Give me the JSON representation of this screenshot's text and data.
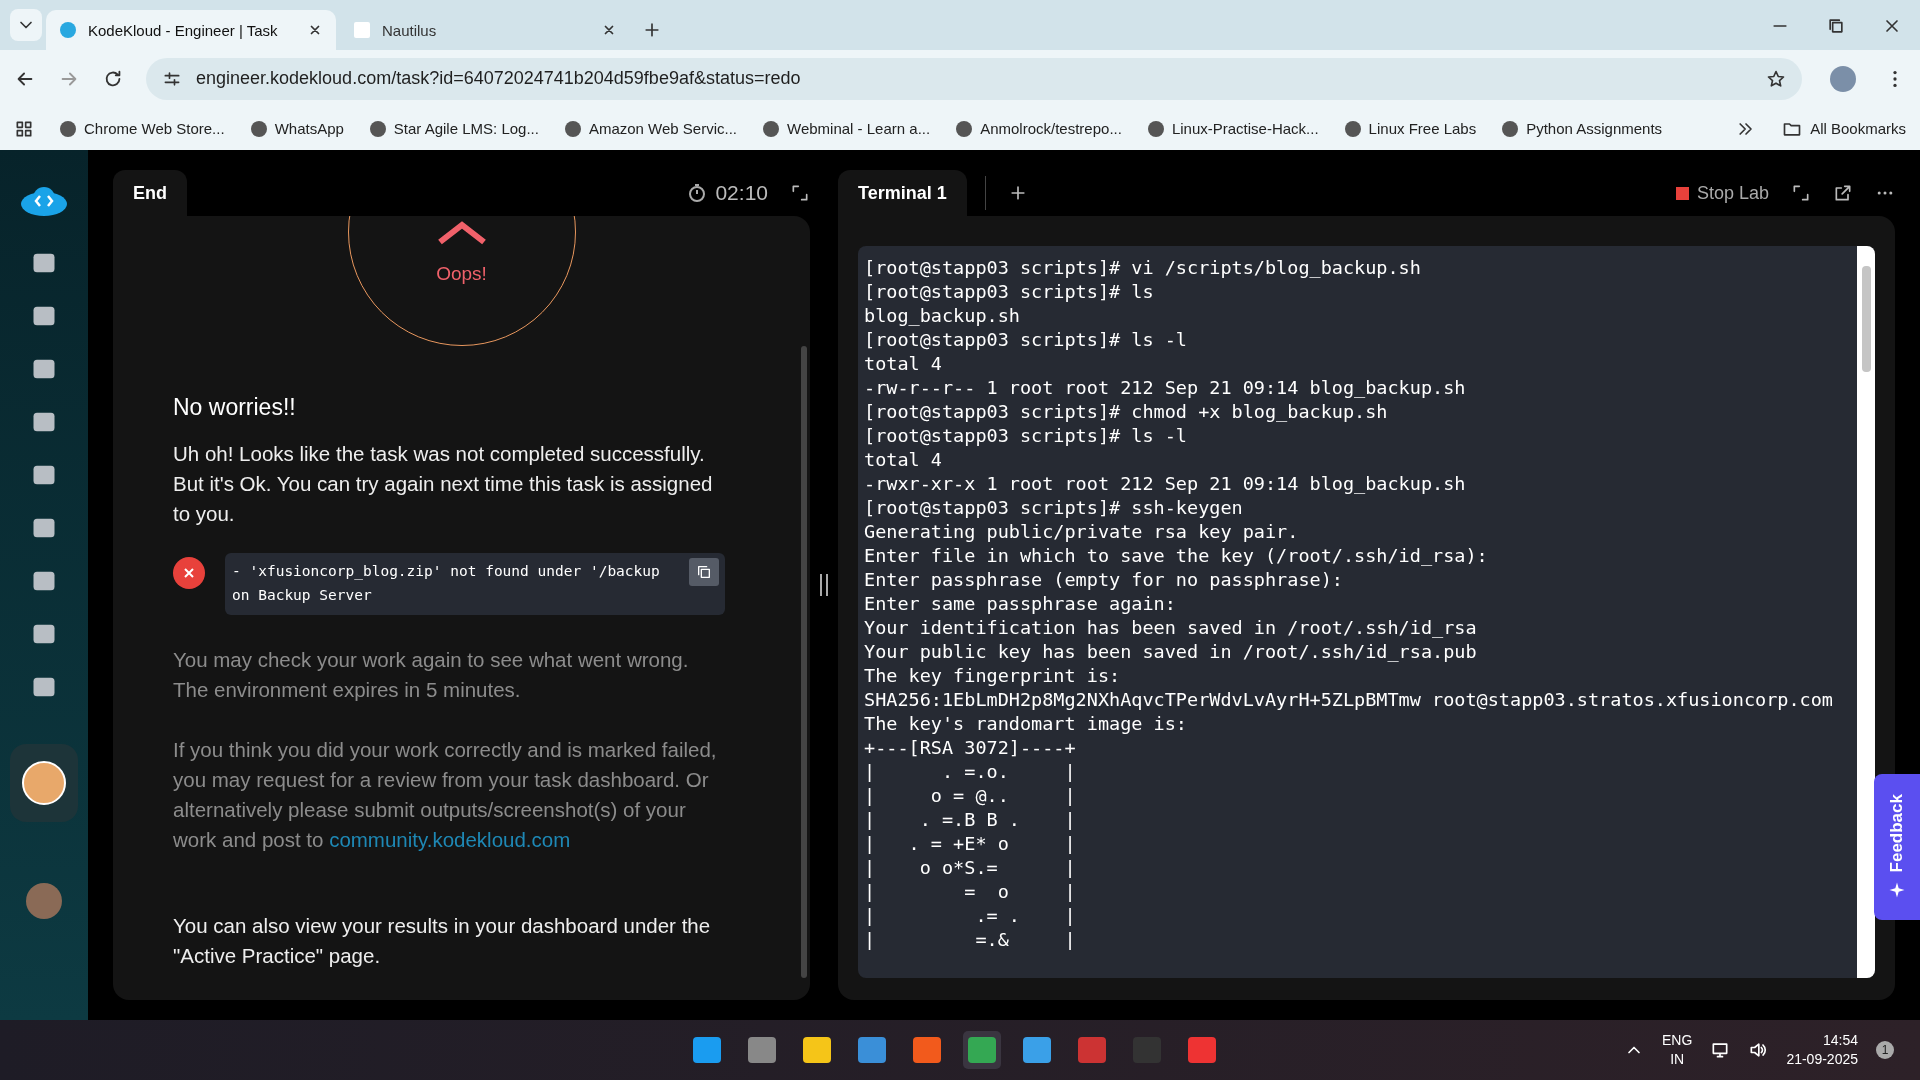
{
  "browser": {
    "tabs": [
      {
        "title": "KodeKloud - Engineer | Task",
        "selected": true
      },
      {
        "title": "Nautilus",
        "selected": false
      }
    ],
    "url": "engineer.kodekloud.com/task?id=64072024741b204d59fbe9af&status=redo",
    "bookmarks": [
      "Chrome Web Store...",
      "WhatsApp",
      "Star Agile LMS: Log...",
      "Amazon Web Servic...",
      "Webminal - Learn a...",
      "Anmolrock/testrepo...",
      "Linux-Practise-Hack...",
      "Linux Free Labs",
      "Python Assignments"
    ],
    "all_bookmarks": "All Bookmarks"
  },
  "task_panel": {
    "tab": "End",
    "timer": "02:10",
    "status": "Oops!",
    "heading": "No worries!!",
    "message": "Uh oh! Looks like the task was not completed successfully. But it's Ok. You can try again next time this task is assigned to you.",
    "error_lines": [
      "- 'xfusioncorp_blog.zip' not found under '/backup",
      "on Backup Server"
    ],
    "check_note": "You may check your work again to see what went wrong. The environment expires in 5 minutes.",
    "review_note": "If you think you did your work correctly and is marked failed, you may request for a review from your task dashboard. Or alternatively please submit outputs/screenshot(s) of your work and post to",
    "review_link": "community.kodekloud.com",
    "results_note": "You can also view your results in your dashboard under the \"Active Practice\" page."
  },
  "terminal": {
    "tab": "Terminal 1",
    "stop_label": "Stop Lab",
    "feedback": "Feedback",
    "lines": [
      "[root@stapp03 scripts]# vi /scripts/blog_backup.sh",
      "[root@stapp03 scripts]# ls",
      "blog_backup.sh",
      "[root@stapp03 scripts]# ls -l",
      "total 4",
      "-rw-r--r-- 1 root root 212 Sep 21 09:14 blog_backup.sh",
      "[root@stapp03 scripts]# chmod +x blog_backup.sh",
      "[root@stapp03 scripts]# ls -l",
      "total 4",
      "-rwxr-xr-x 1 root root 212 Sep 21 09:14 blog_backup.sh",
      "[root@stapp03 scripts]# ssh-keygen",
      "Generating public/private rsa key pair.",
      "Enter file in which to save the key (/root/.ssh/id_rsa):",
      "Enter passphrase (empty for no passphrase):",
      "Enter same passphrase again:",
      "Your identification has been saved in /root/.ssh/id_rsa",
      "Your public key has been saved in /root/.ssh/id_rsa.pub",
      "The key fingerprint is:",
      "SHA256:1EbLmDH2p8Mg2NXhAqvcTPerWdvLvAyrH+5ZLpBMTmw root@stapp03.stratos.xfusioncorp.com",
      "The key's randomart image is:",
      "+---[RSA 3072]----+",
      "|      . =.o.     |",
      "|     o = @..     |",
      "|    . =.B B .    |",
      "|   . = +E* o     |",
      "|    o o*S.=      |",
      "|        =  o     |",
      "|         .= .    |",
      "|         =.&     |"
    ]
  },
  "taskbar": {
    "language": "ENG",
    "region": "IN",
    "time": "14:54",
    "date": "21-09-2025",
    "notifications": "1"
  }
}
